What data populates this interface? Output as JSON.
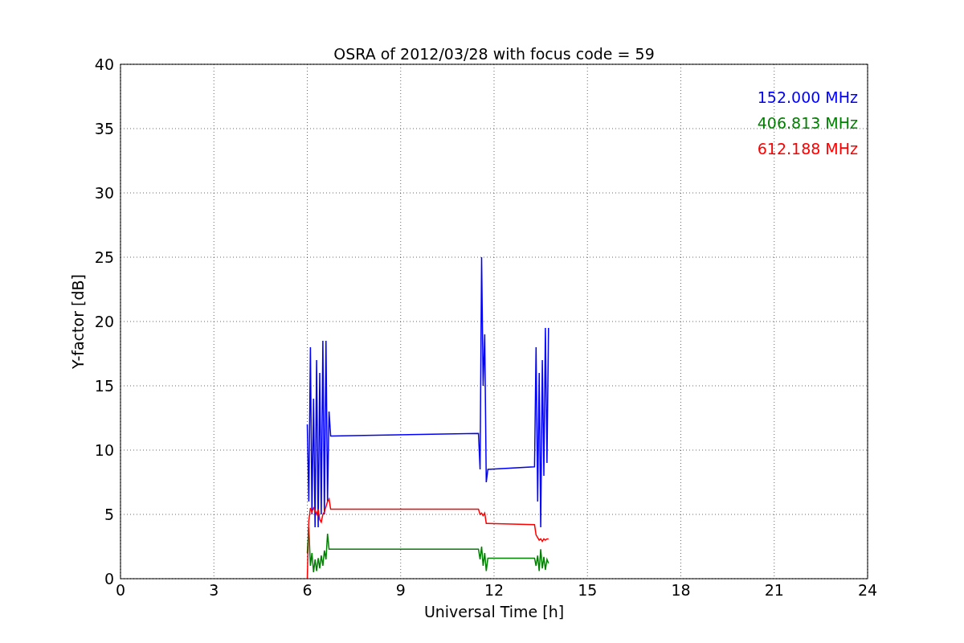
{
  "figure": {
    "chart_data": {
      "type": "line",
      "grid": true,
      "title": "OSRA of 2012/03/28 with focus code = 59",
      "xlabel": "Universal Time [h]",
      "ylabel": "Y-factor [dB]",
      "xlim": [
        0,
        24
      ],
      "ylim": [
        0,
        40
      ],
      "xticks": [
        0,
        3,
        6,
        9,
        12,
        15,
        18,
        21,
        24
      ],
      "yticks": [
        0,
        5,
        10,
        15,
        20,
        25,
        30,
        35,
        40
      ],
      "x": [
        6.0,
        6.05,
        6.1,
        6.15,
        6.2,
        6.25,
        6.3,
        6.35,
        6.4,
        6.45,
        6.5,
        6.55,
        6.6,
        6.65,
        6.7,
        6.75,
        11.5,
        11.55,
        11.6,
        11.65,
        11.7,
        11.75,
        11.8,
        13.3,
        13.35,
        13.4,
        13.45,
        13.5,
        13.55,
        13.6,
        13.65,
        13.7,
        13.75
      ],
      "series": [
        {
          "name": "152.000 MHz",
          "color": "#0000ff",
          "values": [
            12,
            6,
            18,
            5,
            14,
            4,
            17,
            4,
            16,
            5,
            18.5,
            5,
            18.5,
            6,
            13,
            11.1,
            11.3,
            8.5,
            25,
            15,
            19,
            7.5,
            8.5,
            8.7,
            18,
            6,
            16,
            4,
            17,
            8,
            19.5,
            9,
            19.5
          ]
        },
        {
          "name": "406.813 MHz",
          "color": "#008000",
          "values": [
            2,
            4,
            1,
            2,
            0.5,
            1.5,
            0.6,
            1.6,
            0.8,
            1.8,
            1,
            2.2,
            1.5,
            3.5,
            2.3,
            2.3,
            2.3,
            1.5,
            2.5,
            1,
            2,
            0.6,
            1.6,
            1.6,
            1,
            1.8,
            0.6,
            2.3,
            0.8,
            1.7,
            0.7,
            1.5,
            1.2
          ]
        },
        {
          "name": "612.188 MHz",
          "color": "#ff0000",
          "values": [
            0,
            4.5,
            5.5,
            5.2,
            5.5,
            5.3,
            5,
            5.4,
            4.6,
            4.4,
            5,
            5.2,
            5.6,
            6,
            6.2,
            5.4,
            5.4,
            5,
            5.1,
            4.9,
            5.1,
            4.3,
            4.3,
            4.2,
            3.4,
            3.2,
            3,
            3.1,
            2.9,
            3.1,
            3,
            3.1,
            3.1
          ]
        }
      ]
    }
  }
}
